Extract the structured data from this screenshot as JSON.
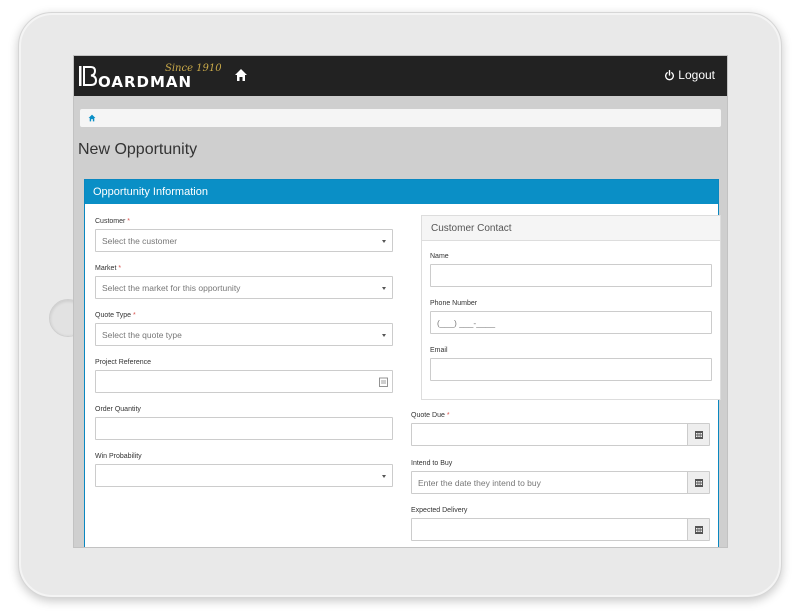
{
  "brand": {
    "since": "Since 1910",
    "wordmark": "OARDMAN"
  },
  "navbar": {
    "home_icon": "home-icon",
    "logout_icon": "power-icon",
    "logout_label": "Logout"
  },
  "breadcrumb": {
    "icon": "home-icon"
  },
  "page": {
    "title": "New Opportunity"
  },
  "panel": {
    "title": "Opportunity Information",
    "fields": {
      "customer": {
        "label": "Customer",
        "required": "*",
        "placeholder": "Select the customer"
      },
      "market": {
        "label": "Market",
        "required": "*",
        "placeholder": "Select the market for this opportunity"
      },
      "quote_type": {
        "label": "Quote Type",
        "required": "*",
        "placeholder": "Select the quote type"
      },
      "project_reference": {
        "label": "Project Reference",
        "value": ""
      },
      "order_quantity": {
        "label": "Order Quantity",
        "value": ""
      },
      "win_probability": {
        "label": "Win Probability",
        "value": ""
      },
      "quote_due": {
        "label": "Quote Due",
        "required": "*",
        "value": ""
      },
      "intend_to_buy": {
        "label": "Intend to Buy",
        "placeholder": "Enter the date they intend to buy"
      },
      "expected_delivery": {
        "label": "Expected Delivery",
        "value": ""
      }
    },
    "contact": {
      "title": "Customer Contact",
      "name_label": "Name",
      "phone_label": "Phone Number",
      "phone_mask": "(___) ___-____",
      "email_label": "Email"
    }
  },
  "colors": {
    "navbar": "#222222",
    "panel_header": "#0a8fc6",
    "required": "#d9534f",
    "brand_gold": "#c9a949"
  }
}
